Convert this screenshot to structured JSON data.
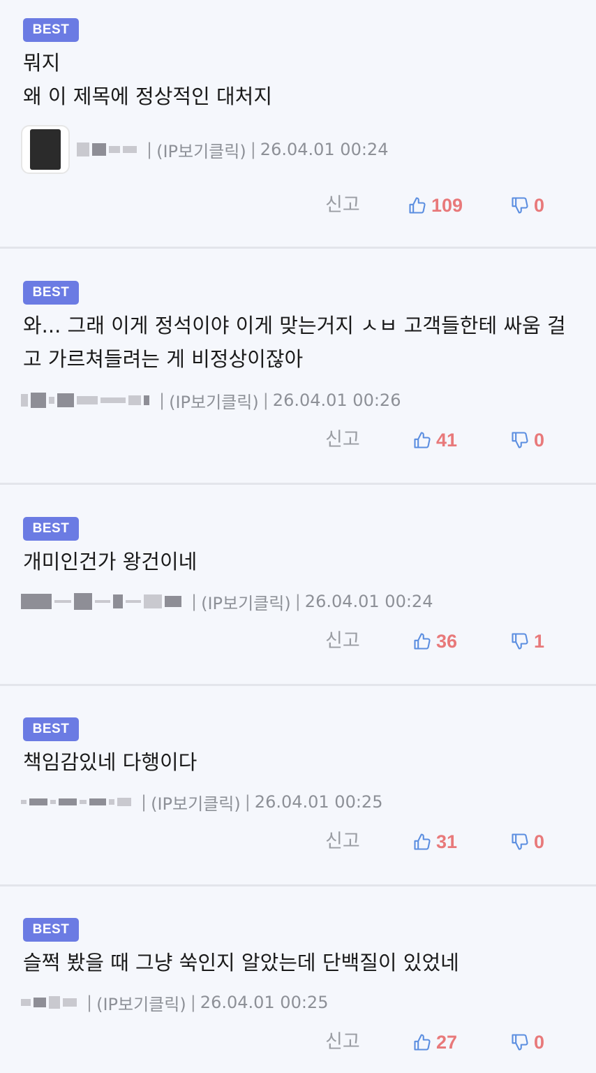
{
  "comments": [
    {
      "badge": "BEST",
      "text": "뭐지\n왜 이 제목에 정상적인 대처지",
      "ip_link": "(IP보기클릭)",
      "timestamp": "26.04.01 00:24",
      "report_label": "신고",
      "likes": "109",
      "dislikes": "0"
    },
    {
      "badge": "BEST",
      "text": "와... 그래 이게 정석이야 이게 맞는거지 ㅅㅂ 고객들한테 싸움 걸고 가르쳐들려는 게 비정상이잖아",
      "ip_link": "(IP보기클릭)",
      "timestamp": "26.04.01 00:26",
      "report_label": "신고",
      "likes": "41",
      "dislikes": "0"
    },
    {
      "badge": "BEST",
      "text": "개미인건가 왕건이네",
      "ip_link": "(IP보기클릭)",
      "timestamp": "26.04.01 00:24",
      "report_label": "신고",
      "likes": "36",
      "dislikes": "1"
    },
    {
      "badge": "BEST",
      "text": "책임감있네 다행이다",
      "ip_link": "(IP보기클릭)",
      "timestamp": "26.04.01 00:25",
      "report_label": "신고",
      "likes": "31",
      "dislikes": "0"
    },
    {
      "badge": "BEST",
      "text": "슬쩍 봤을 때 그냥 쑥인지 알았는데 단백질이 있었네",
      "ip_link": "(IP보기클릭)",
      "timestamp": "26.04.01 00:25",
      "report_label": "신고",
      "likes": "27",
      "dislikes": "0"
    }
  ],
  "colors": {
    "badge_bg": "#6b7be3",
    "like_icon": "#5b8ee0",
    "count_text": "#e8797a",
    "meta_text": "#8d9097",
    "background": "#f5f7fc"
  },
  "icons": {
    "like": "thumbs-up-icon",
    "dislike": "thumbs-down-icon"
  }
}
